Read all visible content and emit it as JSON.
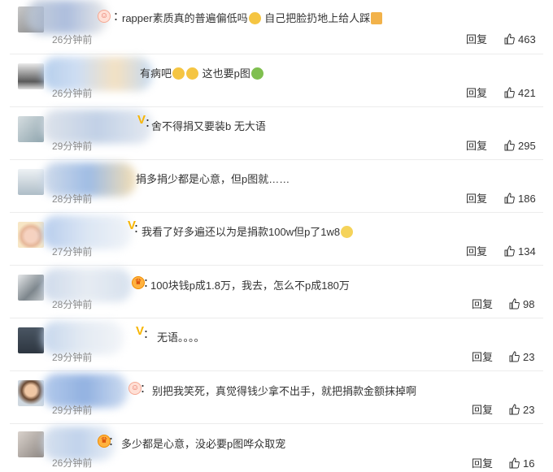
{
  "comments": [
    {
      "text": "rapper素质真的普遍偏低吗",
      "text2": "自己把脸扔地上给人踩",
      "time": "26分钟前",
      "reply": "回复",
      "likes": "463"
    },
    {
      "text": "有病吧",
      "text2": "这也要p图",
      "time": "26分钟前",
      "reply": "回复",
      "likes": "421"
    },
    {
      "text": "舍不得捐又要装b 无大语",
      "time": "29分钟前",
      "reply": "回复",
      "likes": "295"
    },
    {
      "text": "捐多捐少都是心意，但p图就……",
      "time": "28分钟前",
      "reply": "回复",
      "likes": "186"
    },
    {
      "text": "我看了好多遍还以为是捐款100w但p了1w8",
      "time": "27分钟前",
      "reply": "回复",
      "likes": "134"
    },
    {
      "text": "100块钱p成1.8万，我去，怎么不p成180万",
      "time": "28分钟前",
      "reply": "回复",
      "likes": "98"
    },
    {
      "text": "无语。。。。",
      "time": "29分钟前",
      "reply": "回复",
      "likes": "23"
    },
    {
      "text": "别把我笑死，真觉得钱少拿不出手，就把捐款金额抹掉啊",
      "time": "29分钟前",
      "reply": "回复",
      "likes": "23"
    },
    {
      "text": "多少都是心意，没必要p图哗众取宠",
      "time": "26分钟前",
      "reply": "回复",
      "likes": "16"
    }
  ],
  "icons": {
    "like": "thumbs-up-outline-icon",
    "member": "vip-badge-icon"
  },
  "colors": {
    "text": "#333333",
    "time": "#8c8c8c",
    "divider": "#ececec",
    "badge": "#f7b500"
  }
}
